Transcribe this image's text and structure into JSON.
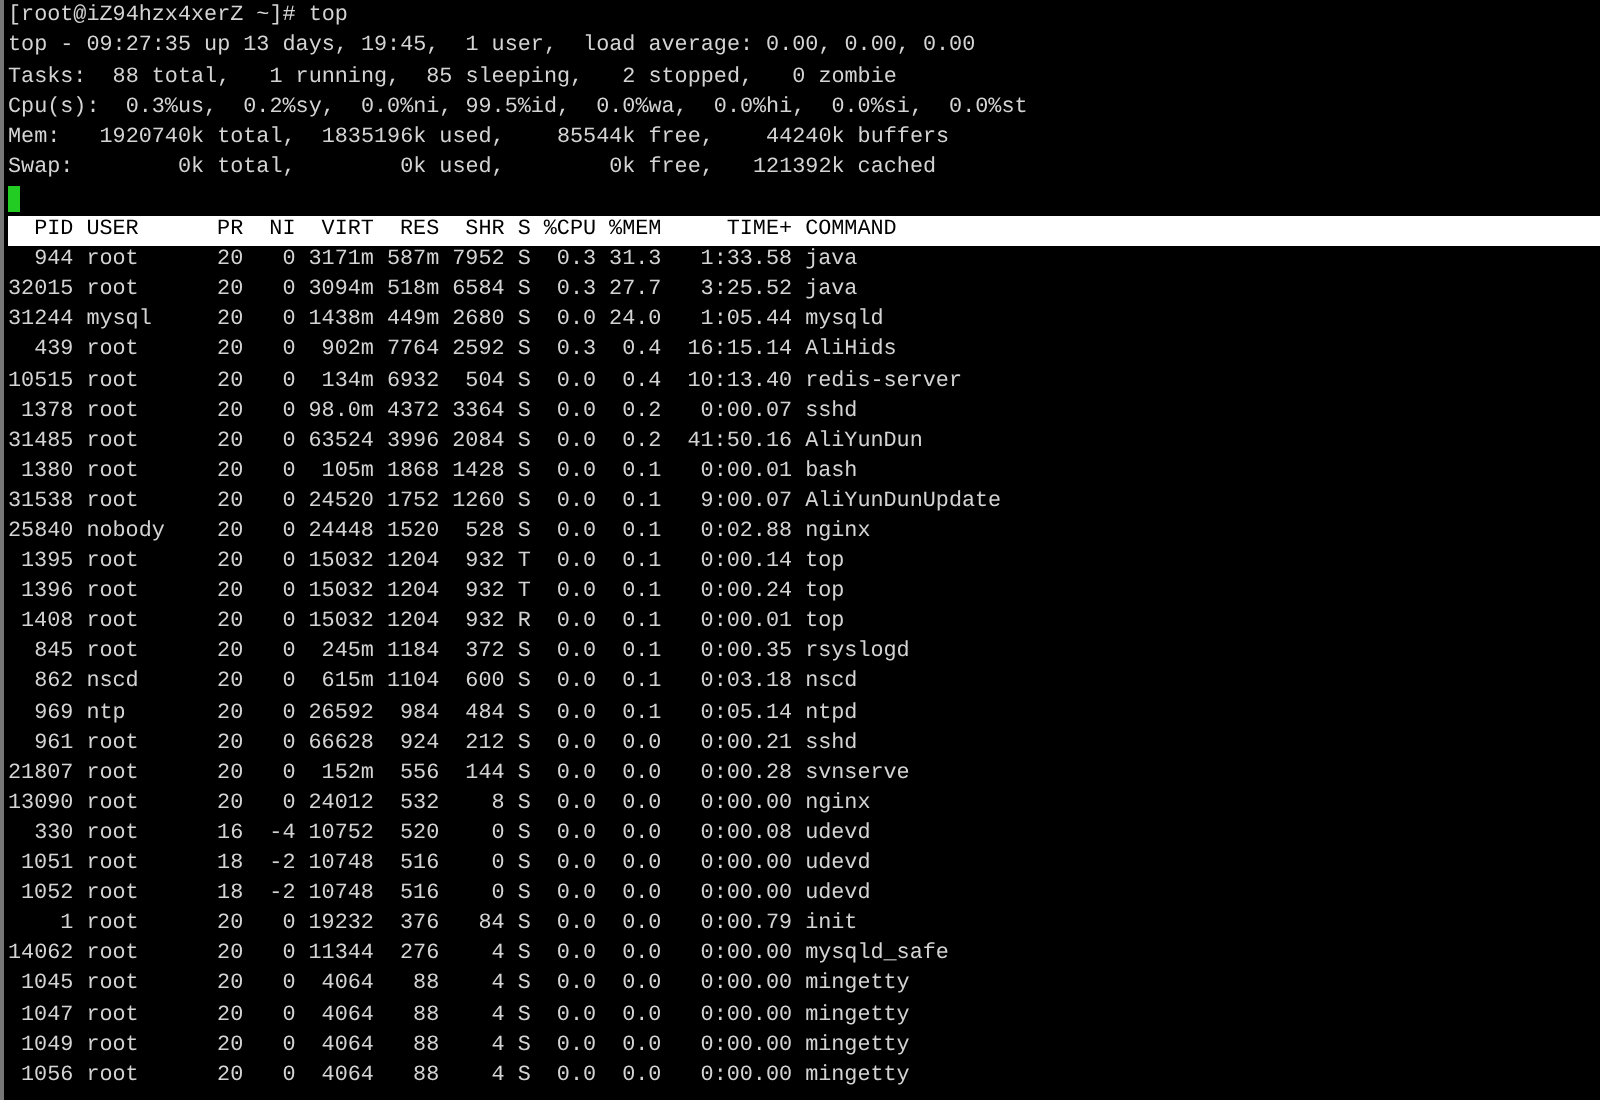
{
  "terminal": {
    "prompt": "[root@iZ94hzx4xerZ ~]# top",
    "summary_lines": [
      "top - 09:27:35 up 13 days, 19:45,  1 user,  load average: 0.00, 0.00, 0.00",
      "Tasks:  88 total,   1 running,  85 sleeping,   2 stopped,   0 zombie",
      "Cpu(s):  0.3%us,  0.2%sy,  0.0%ni, 99.5%id,  0.0%wa,  0.0%hi,  0.0%si,  0.0%st",
      "Mem:   1920740k total,  1835196k used,    85544k free,    44240k buffers",
      "Swap:        0k total,        0k used,        0k free,   121392k cached"
    ],
    "process_table": {
      "columns": [
        "PID",
        "USER",
        "PR",
        "NI",
        "VIRT",
        "RES",
        "SHR",
        "S",
        "%CPU",
        "%MEM",
        "TIME+",
        "COMMAND"
      ],
      "rows": [
        [
          "944",
          "root",
          "20",
          "0",
          "3171m",
          "587m",
          "7952",
          "S",
          "0.3",
          "31.3",
          "1:33.58",
          "java"
        ],
        [
          "32015",
          "root",
          "20",
          "0",
          "3094m",
          "518m",
          "6584",
          "S",
          "0.3",
          "27.7",
          "3:25.52",
          "java"
        ],
        [
          "31244",
          "mysql",
          "20",
          "0",
          "1438m",
          "449m",
          "2680",
          "S",
          "0.0",
          "24.0",
          "1:05.44",
          "mysqld"
        ],
        [
          "439",
          "root",
          "20",
          "0",
          "902m",
          "7764",
          "2592",
          "S",
          "0.3",
          "0.4",
          "16:15.14",
          "AliHids"
        ],
        [
          "10515",
          "root",
          "20",
          "0",
          "134m",
          "6932",
          "504",
          "S",
          "0.0",
          "0.4",
          "10:13.40",
          "redis-server"
        ],
        [
          "1378",
          "root",
          "20",
          "0",
          "98.0m",
          "4372",
          "3364",
          "S",
          "0.0",
          "0.2",
          "0:00.07",
          "sshd"
        ],
        [
          "31485",
          "root",
          "20",
          "0",
          "63524",
          "3996",
          "2084",
          "S",
          "0.0",
          "0.2",
          "41:50.16",
          "AliYunDun"
        ],
        [
          "1380",
          "root",
          "20",
          "0",
          "105m",
          "1868",
          "1428",
          "S",
          "0.0",
          "0.1",
          "0:00.01",
          "bash"
        ],
        [
          "31538",
          "root",
          "20",
          "0",
          "24520",
          "1752",
          "1260",
          "S",
          "0.0",
          "0.1",
          "9:00.07",
          "AliYunDunUpdate"
        ],
        [
          "25840",
          "nobody",
          "20",
          "0",
          "24448",
          "1520",
          "528",
          "S",
          "0.0",
          "0.1",
          "0:02.88",
          "nginx"
        ],
        [
          "1395",
          "root",
          "20",
          "0",
          "15032",
          "1204",
          "932",
          "T",
          "0.0",
          "0.1",
          "0:00.14",
          "top"
        ],
        [
          "1396",
          "root",
          "20",
          "0",
          "15032",
          "1204",
          "932",
          "T",
          "0.0",
          "0.1",
          "0:00.24",
          "top"
        ],
        [
          "1408",
          "root",
          "20",
          "0",
          "15032",
          "1204",
          "932",
          "R",
          "0.0",
          "0.1",
          "0:00.01",
          "top"
        ],
        [
          "845",
          "root",
          "20",
          "0",
          "245m",
          "1184",
          "372",
          "S",
          "0.0",
          "0.1",
          "0:00.35",
          "rsyslogd"
        ],
        [
          "862",
          "nscd",
          "20",
          "0",
          "615m",
          "1104",
          "600",
          "S",
          "0.0",
          "0.1",
          "0:03.18",
          "nscd"
        ],
        [
          "969",
          "ntp",
          "20",
          "0",
          "26592",
          "984",
          "484",
          "S",
          "0.0",
          "0.1",
          "0:05.14",
          "ntpd"
        ],
        [
          "961",
          "root",
          "20",
          "0",
          "66628",
          "924",
          "212",
          "S",
          "0.0",
          "0.0",
          "0:00.21",
          "sshd"
        ],
        [
          "21807",
          "root",
          "20",
          "0",
          "152m",
          "556",
          "144",
          "S",
          "0.0",
          "0.0",
          "0:00.28",
          "svnserve"
        ],
        [
          "13090",
          "root",
          "20",
          "0",
          "24012",
          "532",
          "8",
          "S",
          "0.0",
          "0.0",
          "0:00.00",
          "nginx"
        ],
        [
          "330",
          "root",
          "16",
          "-4",
          "10752",
          "520",
          "0",
          "S",
          "0.0",
          "0.0",
          "0:00.08",
          "udevd"
        ],
        [
          "1051",
          "root",
          "18",
          "-2",
          "10748",
          "516",
          "0",
          "S",
          "0.0",
          "0.0",
          "0:00.00",
          "udevd"
        ],
        [
          "1052",
          "root",
          "18",
          "-2",
          "10748",
          "516",
          "0",
          "S",
          "0.0",
          "0.0",
          "0:00.00",
          "udevd"
        ],
        [
          "1",
          "root",
          "20",
          "0",
          "19232",
          "376",
          "84",
          "S",
          "0.0",
          "0.0",
          "0:00.79",
          "init"
        ],
        [
          "14062",
          "root",
          "20",
          "0",
          "11344",
          "276",
          "4",
          "S",
          "0.0",
          "0.0",
          "0:00.00",
          "mysqld_safe"
        ],
        [
          "1045",
          "root",
          "20",
          "0",
          "4064",
          "88",
          "4",
          "S",
          "0.0",
          "0.0",
          "0:00.00",
          "mingetty"
        ],
        [
          "1047",
          "root",
          "20",
          "0",
          "4064",
          "88",
          "4",
          "S",
          "0.0",
          "0.0",
          "0:00.00",
          "mingetty"
        ],
        [
          "1049",
          "root",
          "20",
          "0",
          "4064",
          "88",
          "4",
          "S",
          "0.0",
          "0.0",
          "0:00.00",
          "mingetty"
        ],
        [
          "1056",
          "root",
          "20",
          "0",
          "4064",
          "88",
          "4",
          "S",
          "0.0",
          "0.0",
          "0:00.00",
          "mingetty"
        ]
      ]
    }
  }
}
